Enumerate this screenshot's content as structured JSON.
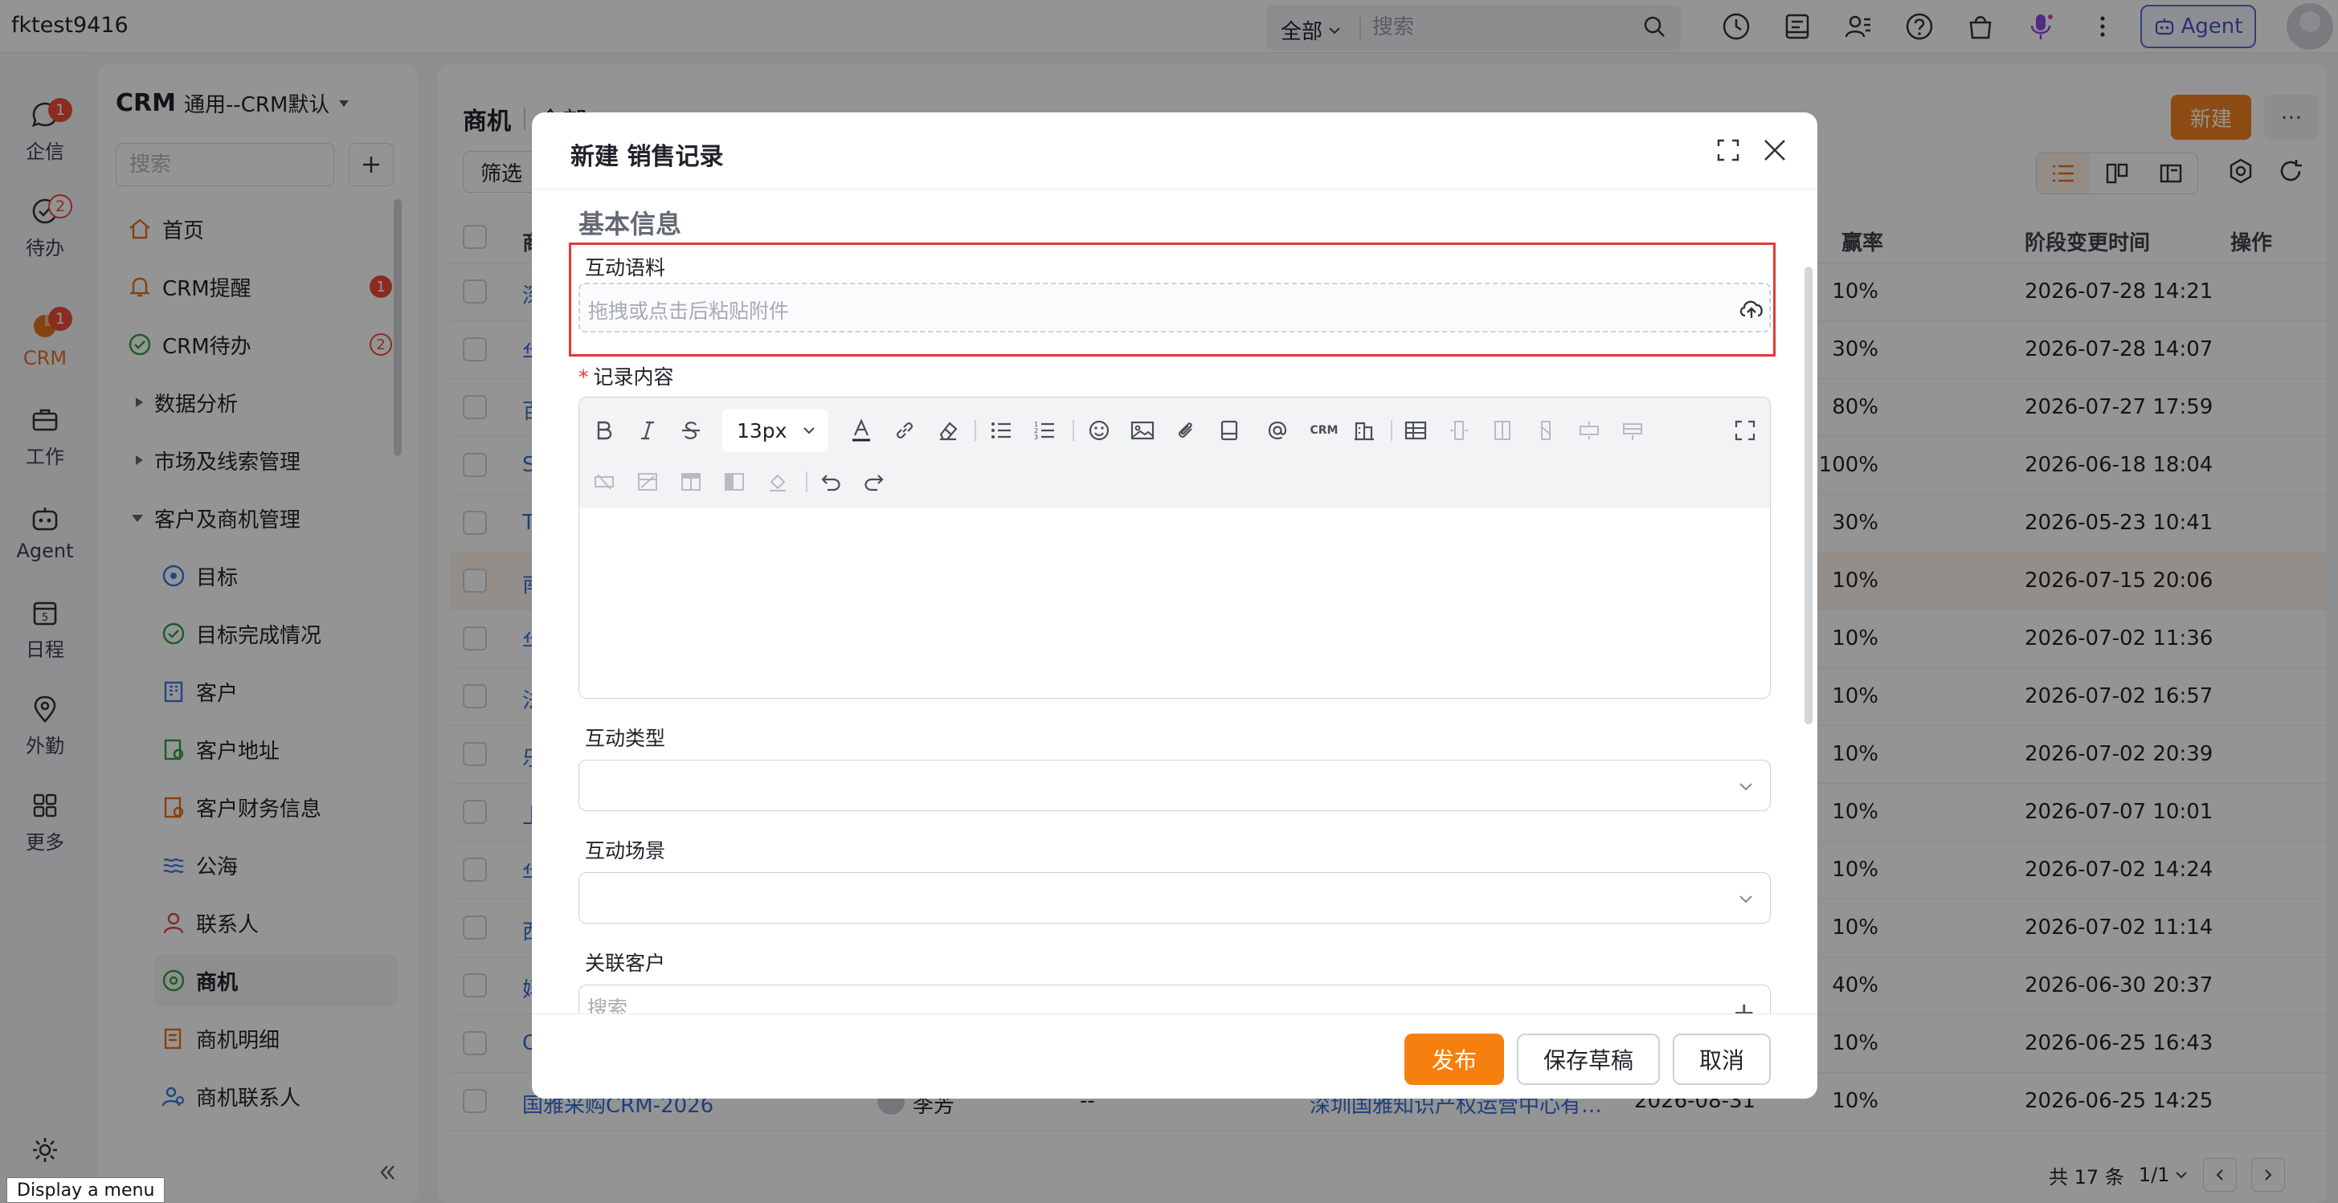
{
  "topbar": {
    "user": "fktest9416",
    "search_scope": "全部",
    "search_placeholder": "搜索",
    "agent_label": "Agent"
  },
  "rail": {
    "items": [
      {
        "label": "企信",
        "icon": "chat-icon",
        "badge": "1"
      },
      {
        "label": "待办",
        "icon": "check-circle-icon",
        "badge": "2"
      },
      {
        "label": "CRM",
        "icon": "crm-icon",
        "badge": "1",
        "active": true
      },
      {
        "label": "工作",
        "icon": "briefcase-icon"
      },
      {
        "label": "Agent",
        "icon": "robot-icon"
      },
      {
        "label": "日程",
        "icon": "calendar-icon",
        "day": "5"
      },
      {
        "label": "外勤",
        "icon": "location-pin-icon"
      },
      {
        "label": "更多",
        "icon": "grid-icon"
      }
    ],
    "tooltip": "Display a menu"
  },
  "subnav": {
    "title": "CRM",
    "subtitle": "通用--CRM默认",
    "search_placeholder": "搜索",
    "items": [
      {
        "label": "首页",
        "badge": ""
      },
      {
        "label": "CRM提醒",
        "badge": "1"
      },
      {
        "label": "CRM待办",
        "badge": "2"
      },
      {
        "label": "数据分析",
        "badge": ""
      },
      {
        "label": "市场及线索管理",
        "badge": ""
      },
      {
        "label": "客户及商机管理",
        "badge": ""
      },
      {
        "label": "目标",
        "badge": ""
      },
      {
        "label": "目标完成情况",
        "badge": ""
      },
      {
        "label": "客户",
        "badge": ""
      },
      {
        "label": "客户地址",
        "badge": ""
      },
      {
        "label": "客户财务信息",
        "badge": ""
      },
      {
        "label": "公海",
        "badge": ""
      },
      {
        "label": "联系人",
        "badge": ""
      },
      {
        "label": "商机",
        "badge": ""
      },
      {
        "label": "商机明细",
        "badge": ""
      },
      {
        "label": "商机联系人",
        "badge": ""
      }
    ]
  },
  "main": {
    "title": "商机",
    "view_name": "全部",
    "filter_label": "筛选",
    "new_label": "新建",
    "more_label": "···",
    "columns": {
      "name": "商",
      "rate": "赢率",
      "changed": "阶段变更时间",
      "ops": "操作"
    },
    "rows": [
      {
        "name": "深",
        "rate": "10%",
        "changed": "2026-07-28 14:21"
      },
      {
        "name": "华",
        "rate": "30%",
        "changed": "2026-07-28 14:07"
      },
      {
        "name": "百",
        "rate": "80%",
        "changed": "2026-07-27 17:59"
      },
      {
        "name": "S",
        "rate": "100%",
        "changed": "2026-06-18 18:04"
      },
      {
        "name": "T",
        "rate": "30%",
        "changed": "2026-05-23 10:41"
      },
      {
        "name": "南",
        "rate": "10%",
        "changed": "2026-07-15 20:06"
      },
      {
        "name": "华",
        "rate": "10%",
        "changed": "2026-07-02 11:36"
      },
      {
        "name": "法",
        "rate": "10%",
        "changed": "2026-07-02 16:57"
      },
      {
        "name": "乐",
        "rate": "10%",
        "changed": "2026-07-02 20:39"
      },
      {
        "name": "上",
        "rate": "10%",
        "changed": "2026-07-07 10:01"
      },
      {
        "name": "华",
        "rate": "10%",
        "changed": "2026-07-02 14:24"
      },
      {
        "name": "西",
        "rate": "10%",
        "changed": "2026-07-02 11:14"
      },
      {
        "name": "妈",
        "rate": "40%",
        "changed": "2026-06-30 20:37"
      },
      {
        "name": "C",
        "rate": "10%",
        "changed": "2026-06-25 16:43"
      },
      {
        "name": "国雅采购CRM-2026",
        "owner": "李芳",
        "dash": "--",
        "customer": "深圳国雅知识产权运营中心有…",
        "date": "2026-08-31",
        "rate": "10%",
        "changed": "2026-06-25 14:25"
      }
    ],
    "pager": {
      "total": "共 17 条",
      "page": "1/1"
    }
  },
  "modal": {
    "title": "新建 销售记录",
    "section": "基本信息",
    "attach": {
      "label": "互动语料",
      "hint": "拖拽或点击后粘贴附件"
    },
    "content_label": "记录内容",
    "font_size": "13px",
    "toolbar_crm": "CRM",
    "type_label": "互动类型",
    "scene_label": "互动场景",
    "customer_label": "关联客户",
    "customer_placeholder": "搜索",
    "publish": "发布",
    "save_draft": "保存草稿",
    "cancel": "取消"
  },
  "colors": {
    "accent": "#f5800f",
    "danger": "#ef4a3c",
    "link": "#2f6fd6",
    "agent": "#4955c5"
  }
}
